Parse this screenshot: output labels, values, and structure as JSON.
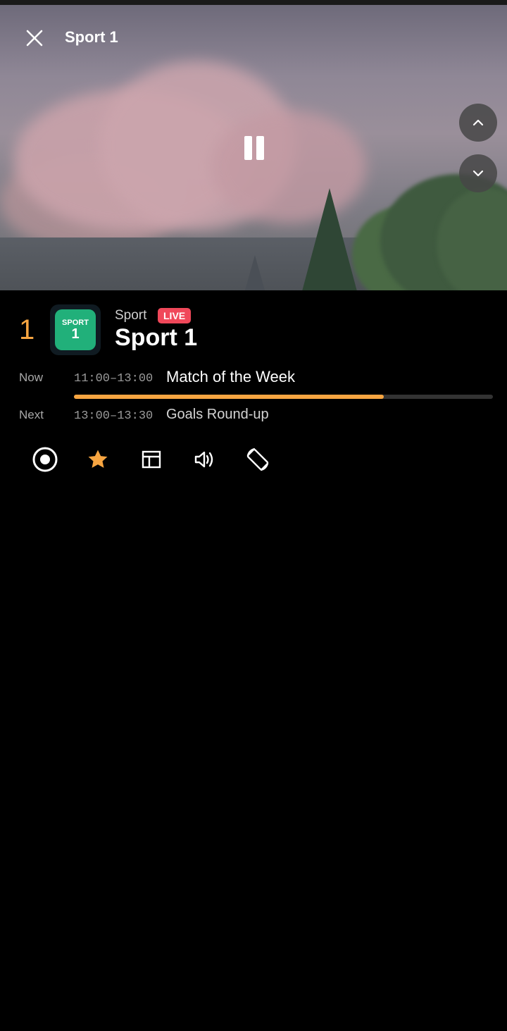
{
  "player": {
    "title": "Sport 1",
    "icons": {
      "close": "close-icon",
      "pause": "pause-icon",
      "up": "chevron-up-icon",
      "down": "chevron-down-icon"
    }
  },
  "channel": {
    "number": "1",
    "logo_top": "SPORT",
    "logo_num": "1",
    "category": "Sport",
    "live_badge": "LIVE",
    "name": "Sport 1"
  },
  "schedule": {
    "now": {
      "label": "Now",
      "time": "11:00–13:00",
      "title": "Match of the Week",
      "progress": 0.74
    },
    "next": {
      "label": "Next",
      "time": "13:00–13:30",
      "title": "Goals Round-up"
    }
  },
  "actions": [
    {
      "icon": "record-icon"
    },
    {
      "icon": "star-icon"
    },
    {
      "icon": "layout-icon"
    },
    {
      "icon": "volume-icon"
    },
    {
      "icon": "rotate-screen-icon"
    }
  ],
  "colors": {
    "accent": "#f7a541",
    "live": "#f0485a",
    "logo_bg": "#21b07a"
  }
}
